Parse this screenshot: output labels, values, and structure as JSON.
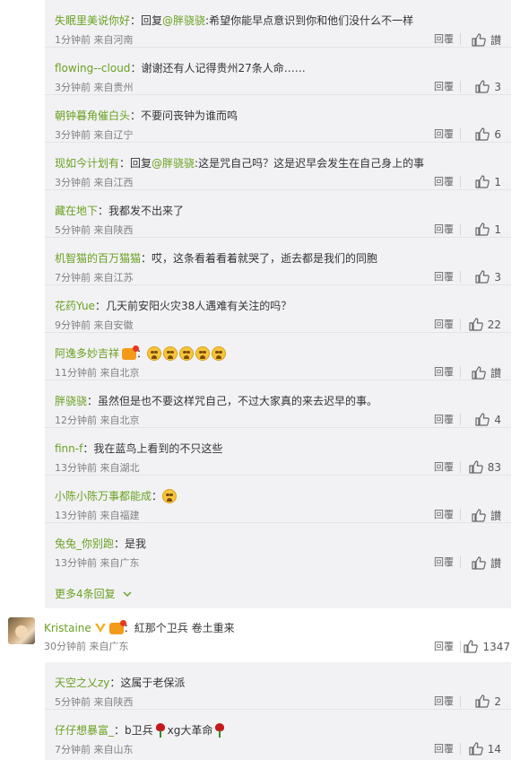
{
  "replies": [
    {
      "user": "失眠里美说你好",
      "prefix": "：回复",
      "mention": "@胖骁骁",
      "text": ":希望你能早点意识到你和他们没什么不一样",
      "meta": "1分钟前 来自河南",
      "reply": "回覆",
      "likes": "讃"
    },
    {
      "user": "flowing--cloud",
      "text": "：谢谢还有人记得贵州27条人命……",
      "meta": "3分钟前 来自贵州",
      "reply": "回覆",
      "likes": "3"
    },
    {
      "user": "朝钟暮角催白头",
      "text": "：不要问丧钟为谁而鸣",
      "meta": "3分钟前 来自辽宁",
      "reply": "回覆",
      "likes": "6"
    },
    {
      "user": "现如今计划有",
      "prefix": "：回复",
      "mention": "@胖骁骁",
      "text": ":这是咒自己吗？这是迟早会发生在自己身上的事",
      "meta": "3分钟前 来自江西",
      "reply": "回覆",
      "likes": "1"
    },
    {
      "user": "藏在地下",
      "text": "：我都发不出来了",
      "meta": "5分钟前 来自陕西",
      "reply": "回覆",
      "likes": "1"
    },
    {
      "user": "机智猫的百万猫猫",
      "text": "：哎，这条看着看着就哭了，逝去都是我们的同胞",
      "meta": "7分钟前 来自江苏",
      "reply": "回覆",
      "likes": "3"
    },
    {
      "user": "花药Yue",
      "text": "：几天前安阳火灾38人遇难有关注的吗？",
      "meta": "9分钟前 来自安徽",
      "reply": "回覆",
      "likes": "22"
    },
    {
      "user": "阿逸多妙吉祥",
      "text": "：",
      "emojis": 5,
      "badge": true,
      "meta": "11分钟前 来自北京",
      "reply": "回覆",
      "likes": "讃"
    },
    {
      "user": "胖骁骁",
      "text": "：虽然但是也不要这样咒自己，不过大家真的来去迟早的事。",
      "meta": "12分钟前 来自北京",
      "reply": "回覆",
      "likes": "4"
    },
    {
      "user": "finn-f",
      "text": "：我在蓝鸟上看到的不只这些",
      "meta": "13分钟前 来自湖北",
      "reply": "回覆",
      "likes": "83"
    },
    {
      "user": "小陈小陈万事都能成",
      "text": "：",
      "emojis": 1,
      "meta": "13分钟前 来自福建",
      "reply": "回覆",
      "likes": "讃"
    },
    {
      "user": "兔兔_你别跑",
      "text": "：是我",
      "meta": "13分钟前 来自广东",
      "reply": "回覆",
      "likes": "讃"
    }
  ],
  "more": {
    "label": "更多4条回复"
  },
  "top_comment": {
    "user": "Kristaine",
    "text": "：紅那个卫兵 卷土重来",
    "meta": "30分钟前 来自广东",
    "reply": "回覆",
    "likes": "1347"
  },
  "replies2": [
    {
      "user": "天空之乂zy",
      "text": "：这属于老保派",
      "meta": "5分钟前 来自陕西",
      "reply": "回覆",
      "likes": "2"
    },
    {
      "user": "仔仔想暴富_",
      "text": "：b卫兵",
      "text2": "xg大革命",
      "meta": "7分钟前 来自山东",
      "reply": "回覆",
      "likes": "14"
    }
  ],
  "colors": {
    "username": "#6aa120",
    "panel": "#f2f2f5",
    "meta": "#808080"
  },
  "icons": {
    "like": "thumbs-up-icon",
    "more": "chevron-down-icon",
    "verified": "v-verified-icon"
  }
}
